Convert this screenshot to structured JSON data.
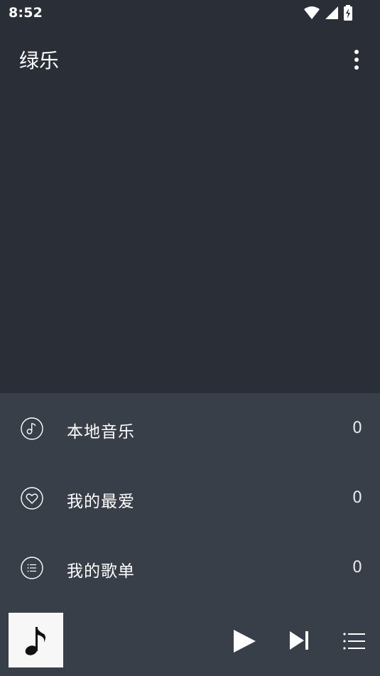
{
  "status_bar": {
    "time": "8:52",
    "icons": [
      "wifi-icon",
      "signal-icon",
      "battery-charging-icon"
    ]
  },
  "toolbar": {
    "title": "绿乐",
    "more_icon": "more-vert-icon"
  },
  "library": {
    "items": [
      {
        "label": "本地音乐",
        "count": "0",
        "icon": "music-note-icon"
      },
      {
        "label": "我的最爱",
        "count": "0",
        "icon": "heart-icon"
      },
      {
        "label": "我的歌单",
        "count": "0",
        "icon": "playlist-icon"
      }
    ]
  },
  "player": {
    "album_art_icon": "music-note-icon",
    "controls": [
      "play-icon",
      "skip-next-icon",
      "queue-list-icon"
    ]
  },
  "colors": {
    "background": "#2a2f37",
    "panel": "#393f48",
    "text": "#ffffff",
    "album_art_bg": "#f7f7f7"
  }
}
